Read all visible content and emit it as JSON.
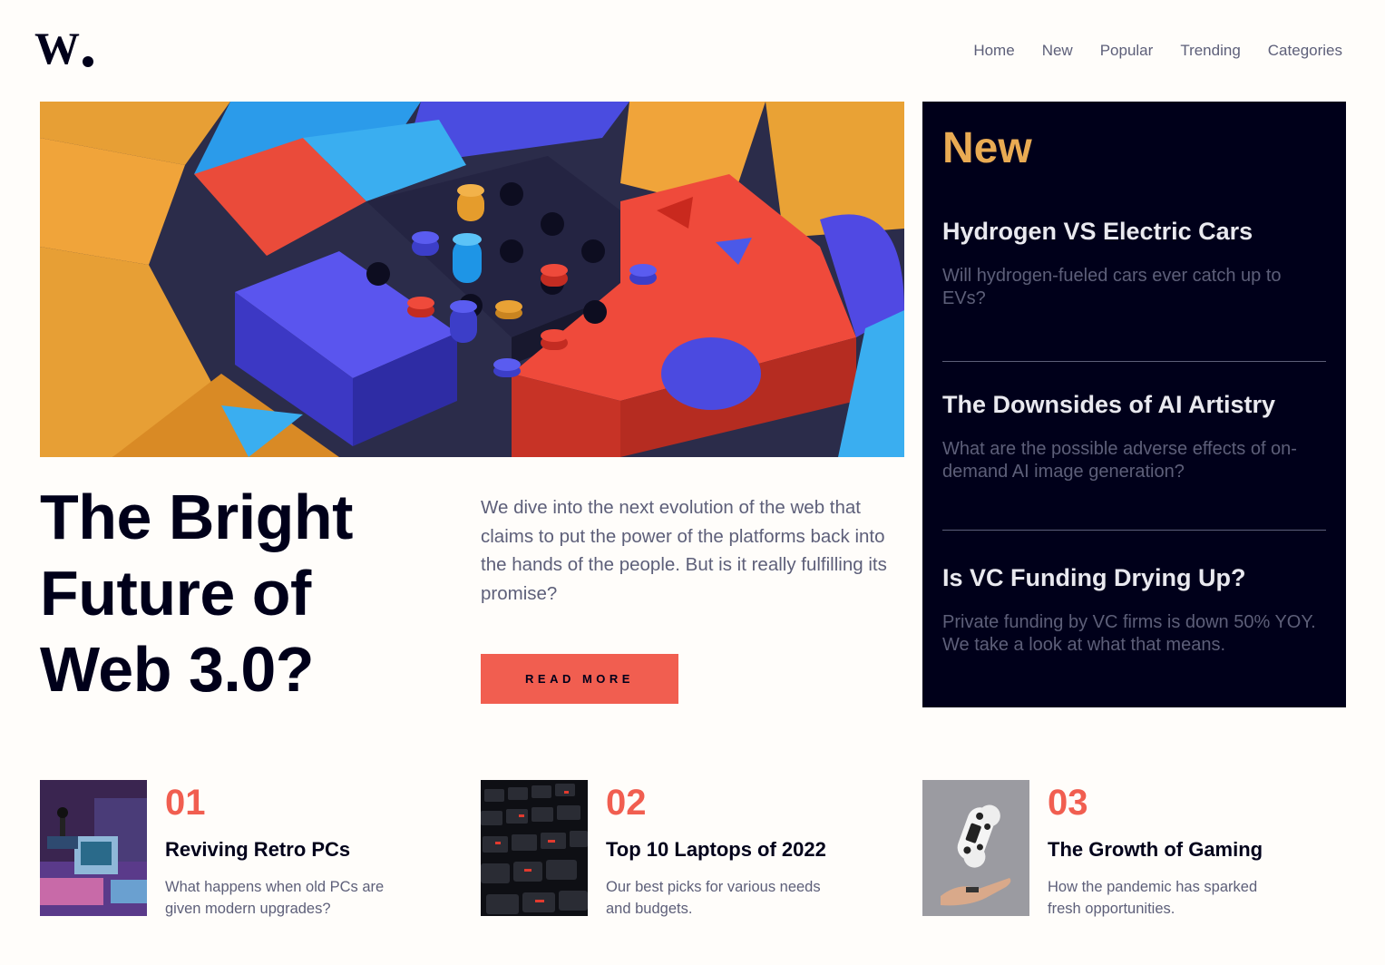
{
  "brand": {
    "logo_text": "W."
  },
  "nav": {
    "items": [
      "Home",
      "New",
      "Popular",
      "Trending",
      "Categories"
    ]
  },
  "hero": {
    "title": "The Bright Future of Web 3.0?",
    "description": "We dive into the next evolution of the web that claims to put the power of the platforms back into the hands of the people. But is it really fulfilling its promise?",
    "cta_label": "READ MORE"
  },
  "new_section": {
    "title": "New",
    "items": [
      {
        "title": "Hydrogen VS Electric Cars",
        "description": "Will hydrogen-fueled cars ever catch up to EVs?"
      },
      {
        "title": "The Downsides of AI Artistry",
        "description": "What are the possible adverse effects of on-demand AI image generation?"
      },
      {
        "title": "Is VC Funding Drying Up?",
        "description": "Private funding by VC firms is down 50% YOY. We take a look at what that means."
      }
    ]
  },
  "featured": [
    {
      "number": "01",
      "title": "Reviving Retro PCs",
      "description": "What happens when old PCs are given modern upgrades?"
    },
    {
      "number": "02",
      "title": "Top 10 Laptops of 2022",
      "description": "Our best picks for various needs and budgets."
    },
    {
      "number": "03",
      "title": "The Growth of Gaming",
      "description": "How the pandemic has sparked fresh opportunities."
    }
  ],
  "colors": {
    "accent_red": "#f15e50",
    "accent_orange": "#e9ab53",
    "dark_blue": "#00001a",
    "grayish_blue": "#5d5f79",
    "off_white": "#fffdfa"
  }
}
